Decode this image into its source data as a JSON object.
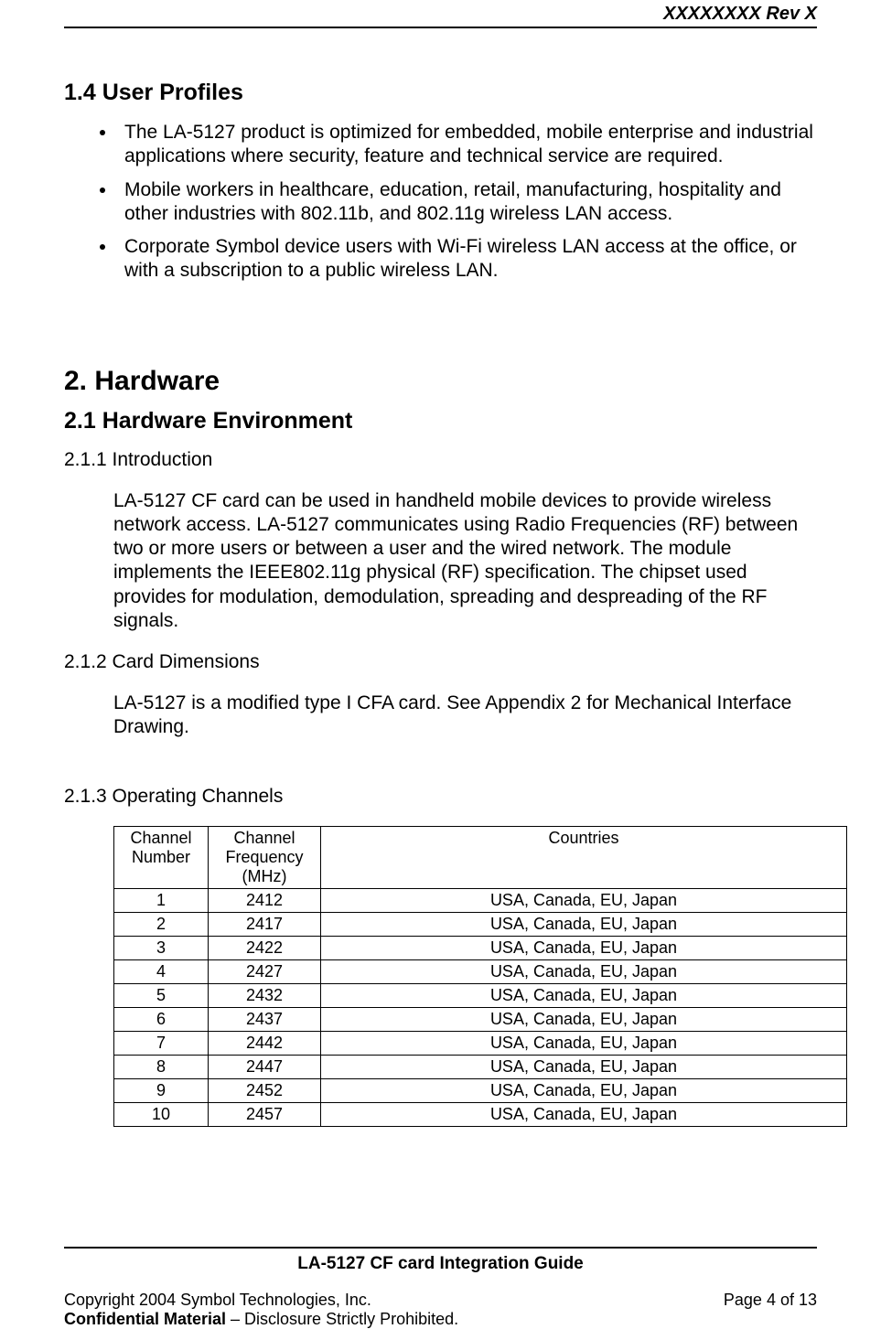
{
  "header": {
    "revision": "XXXXXXXX Rev X"
  },
  "sections": {
    "userProfiles": {
      "heading": "1.4  User Profiles",
      "bullets": [
        "The LA-5127 product is optimized for embedded, mobile enterprise and industrial applications where security, feature and technical service are required.",
        "Mobile workers in healthcare, education, retail, manufacturing, hospitality and other industries with 802.11b, and 802.11g wireless LAN access.",
        "Corporate Symbol device users with Wi-Fi wireless LAN access at the office, or with a subscription to a public wireless LAN."
      ]
    },
    "hardware": {
      "heading": "2.  Hardware",
      "env": {
        "heading": "2.1  Hardware Environment",
        "intro": {
          "heading": "2.1.1  Introduction",
          "text": "LA-5127 CF card can be used in handheld mobile devices to provide wireless network access. LA-5127 communicates using Radio Frequencies (RF) between two or more users or between a user and the wired network. The module implements the IEEE802.11g physical (RF) specification. The chipset used provides for modulation, demodulation, spreading and despreading of the RF signals."
        },
        "dims": {
          "heading": "2.1.2  Card Dimensions",
          "text": "LA-5127 is a modified type I CFA card. See Appendix 2 for Mechanical Interface Drawing."
        },
        "channels": {
          "heading": "2.1.3  Operating Channels",
          "headers": [
            "Channel Number",
            "Channel Frequency (MHz)",
            "Countries"
          ],
          "rows": [
            {
              "num": "1",
              "freq": "2412",
              "countries": "USA, Canada, EU, Japan"
            },
            {
              "num": "2",
              "freq": "2417",
              "countries": "USA, Canada, EU, Japan"
            },
            {
              "num": "3",
              "freq": "2422",
              "countries": "USA, Canada, EU, Japan"
            },
            {
              "num": "4",
              "freq": "2427",
              "countries": "USA, Canada, EU, Japan"
            },
            {
              "num": "5",
              "freq": "2432",
              "countries": "USA, Canada, EU, Japan"
            },
            {
              "num": "6",
              "freq": "2437",
              "countries": "USA, Canada, EU, Japan"
            },
            {
              "num": "7",
              "freq": "2442",
              "countries": "USA, Canada, EU, Japan"
            },
            {
              "num": "8",
              "freq": "2447",
              "countries": "USA, Canada, EU, Japan"
            },
            {
              "num": "9",
              "freq": "2452",
              "countries": "USA, Canada, EU, Japan"
            },
            {
              "num": "10",
              "freq": "2457",
              "countries": "USA, Canada, EU, Japan"
            }
          ]
        }
      }
    }
  },
  "footer": {
    "title": "LA-5127 CF card Integration Guide",
    "copyright": "Copyright 2004 Symbol Technologies, Inc.",
    "page": "Page 4 of 13",
    "confidential_bold": "Confidential Material",
    "confidential_rest": " – Disclosure Strictly Prohibited."
  }
}
